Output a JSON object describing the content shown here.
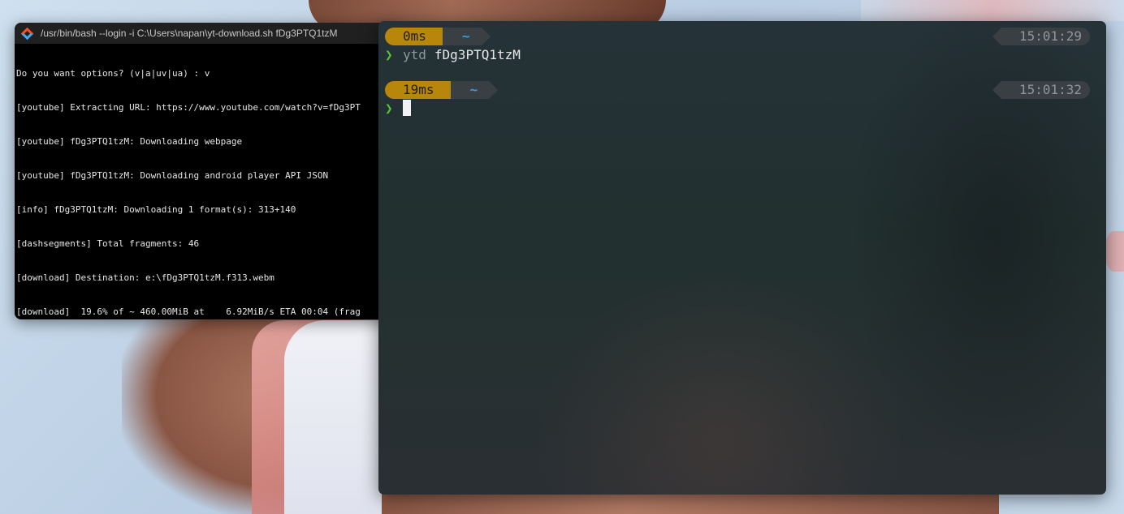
{
  "mintty": {
    "title": "/usr/bin/bash --login -i C:\\Users\\napan\\yt-download.sh fDg3PTQ1tzM",
    "lines": [
      "Do you want options? (v|a|uv|ua) : v",
      "[youtube] Extracting URL: https://www.youtube.com/watch?v=fDg3PT",
      "[youtube] fDg3PTQ1tzM: Downloading webpage",
      "[youtube] fDg3PTQ1tzM: Downloading android player API JSON",
      "[info] fDg3PTQ1tzM: Downloading 1 format(s): 313+140",
      "[dashsegments] Total fragments: 46",
      "[download] Destination: e:\\fDg3PTQ1tzM.f313.webm",
      "[download]  19.6% of ~ 460.00MiB at    6.92MiB/s ETA 00:04 (frag"
    ]
  },
  "terminal": {
    "prompts": [
      {
        "duration": "0ms",
        "dir": "~",
        "time": "15:01:29",
        "command": "ytd",
        "argument": "fDg3PTQ1tzM"
      },
      {
        "duration": "19ms",
        "dir": "~",
        "time": "15:01:32"
      }
    ],
    "prompt_symbol": "❯"
  },
  "colors": {
    "duration_segment": "#b8860b",
    "dir_color": "#3b9fe0",
    "prompt_symbol": "#57c43a"
  }
}
